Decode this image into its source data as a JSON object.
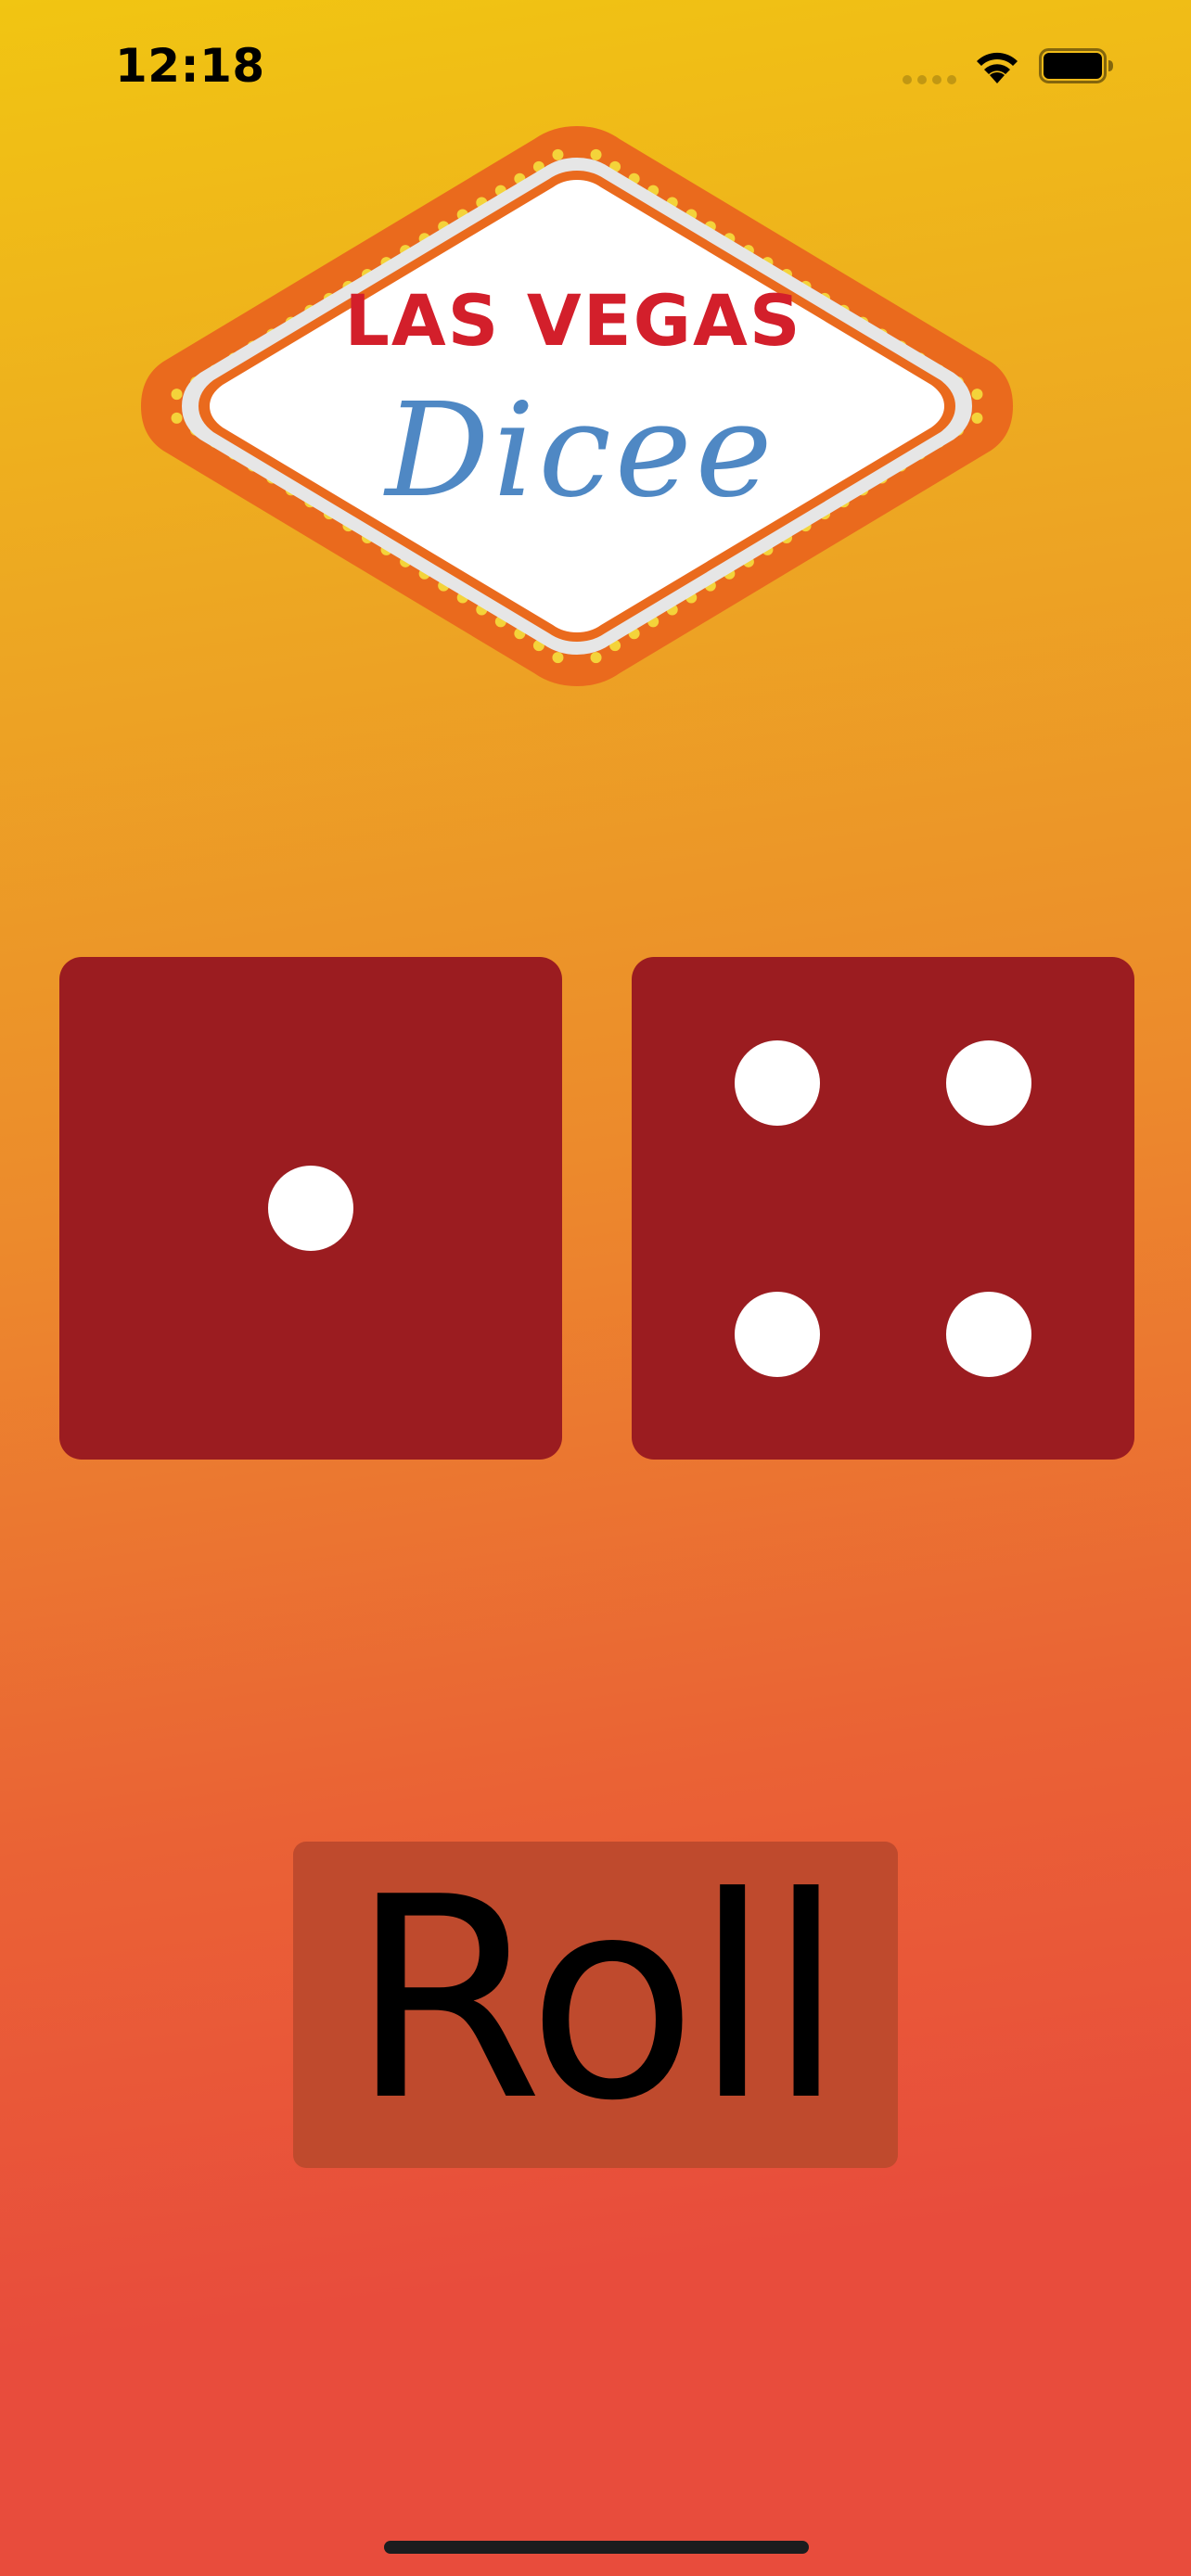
{
  "status_bar": {
    "time": "12:18"
  },
  "logo": {
    "line1": "LAS VEGAS",
    "line2": "Dicee",
    "colors": {
      "frame": "#ea6a1d",
      "bulb": "#f4d33a",
      "line1_text": "#d31f2b",
      "line2_text": "#4f88c4"
    }
  },
  "dice": {
    "left": {
      "value": 1
    },
    "right": {
      "value": 4
    },
    "colors": {
      "face": "#9b1c20",
      "pip": "#ffffff"
    }
  },
  "roll_button": {
    "label": "Roll",
    "background": "#bf4a2d"
  },
  "icons": [
    "cellular-signal-icon",
    "wifi-icon",
    "battery-icon"
  ]
}
